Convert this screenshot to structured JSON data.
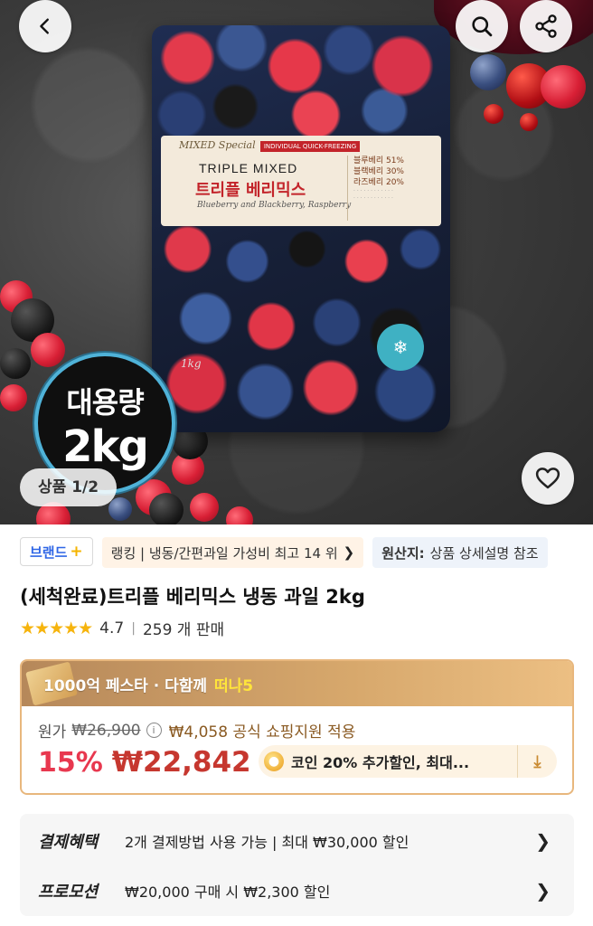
{
  "hero": {
    "package": {
      "brand_script": "MIXED Special",
      "individual": "INDIVIDUAL QUICK-FREEZING",
      "name_en": "TRIPLE MIXED",
      "name_ko": "트리플 베리믹스",
      "subtitle": "Blueberry and Blackberry, Raspberry",
      "composition": [
        "블루베리 51%",
        "블랙베리 30%",
        "라즈베리 20%"
      ],
      "weight": "1kg"
    },
    "badge": {
      "line1": "대용량",
      "line2": "2kg"
    },
    "page_indicator": "상품 1/2"
  },
  "tags": {
    "brand": "브랜드",
    "brand_plus": "+",
    "ranking": "랭킹 | 냉동/간편과일 가성비 최고 14 위",
    "origin_label": "원산지:",
    "origin_value": "상품 상세설명 참조"
  },
  "product": {
    "title": "(세척완료)트리플 베리믹스 냉동 과일 2kg",
    "rating": "4.7",
    "sales": "259 개 판매"
  },
  "promo": {
    "festival": "1000억 페스타 · 다함께",
    "festival_highlight": "떠나5",
    "original_label": "원가",
    "original_price": "₩26,900",
    "discount_note": "₩4,058 공식 쇼핑지원 적용",
    "discount_pct": "15%",
    "final_price": "₩22,842",
    "coin_text": "코인 20% 추가할인, 최대..."
  },
  "benefits": [
    {
      "label": "결제혜택",
      "desc": "2개 결제방법 사용 가능 | 최대 ₩30,000 할인"
    },
    {
      "label": "프로모션",
      "desc": "₩20,000 구매 시 ₩2,300 할인"
    }
  ],
  "colors": {
    "accent_red": "#e8384f",
    "brand_blue": "#2f66e6",
    "star": "#f6b40d",
    "promo_gold": "#d7a86c"
  }
}
